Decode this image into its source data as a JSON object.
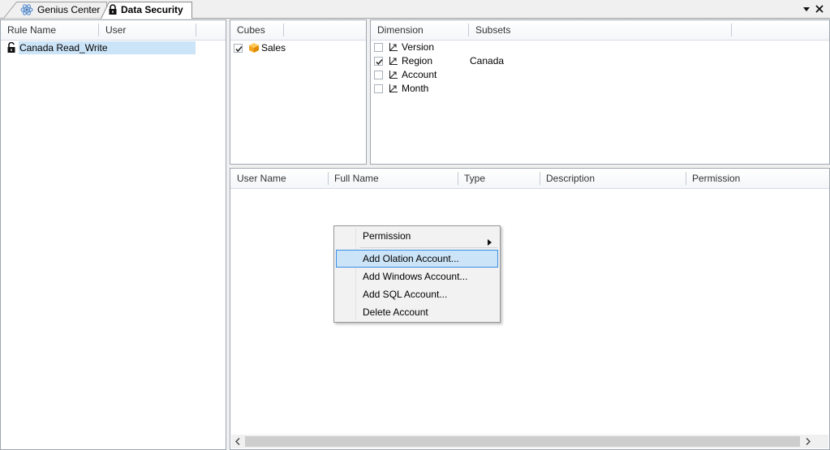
{
  "tabs": [
    {
      "label": "Genius Center",
      "icon": "atom-icon",
      "active": false
    },
    {
      "label": "Data Security",
      "icon": "lock-icon",
      "active": true
    }
  ],
  "window_controls": {
    "dropdown": "chevron-down-icon",
    "close": "close-icon"
  },
  "rules_panel": {
    "columns": [
      "Rule Name",
      "User"
    ],
    "rows": [
      {
        "rule_name": "Canada Read_Write",
        "user": "",
        "icon": "unlock-icon",
        "selected": true
      }
    ]
  },
  "cubes_panel": {
    "columns": [
      "Cubes"
    ],
    "rows": [
      {
        "name": "Sales",
        "checked": true,
        "icon": "cube-icon"
      }
    ]
  },
  "dimension_panel": {
    "columns": [
      "Dimension",
      "Subsets"
    ],
    "rows": [
      {
        "dimension": "Version",
        "subset": "",
        "checked": false
      },
      {
        "dimension": "Region",
        "subset": "Canada",
        "checked": true
      },
      {
        "dimension": "Account",
        "subset": "",
        "checked": false
      },
      {
        "dimension": "Month",
        "subset": "",
        "checked": false
      }
    ]
  },
  "users_panel": {
    "columns": [
      "User Name",
      "Full Name",
      "Type",
      "Description",
      "Permission"
    ],
    "rows": []
  },
  "context_menu": {
    "items": [
      {
        "label": "Permission",
        "has_submenu": true
      },
      {
        "label": "Add Olation Account...",
        "highlighted": true
      },
      {
        "label": "Add Windows Account..."
      },
      {
        "label": "Add SQL Account..."
      },
      {
        "label": "Delete Account"
      }
    ]
  },
  "colors": {
    "selection": "#cce4f7",
    "highlight_border": "#3a8ee6",
    "cube_icon": "#f5a623",
    "panel_border": "#9ea7b0"
  }
}
